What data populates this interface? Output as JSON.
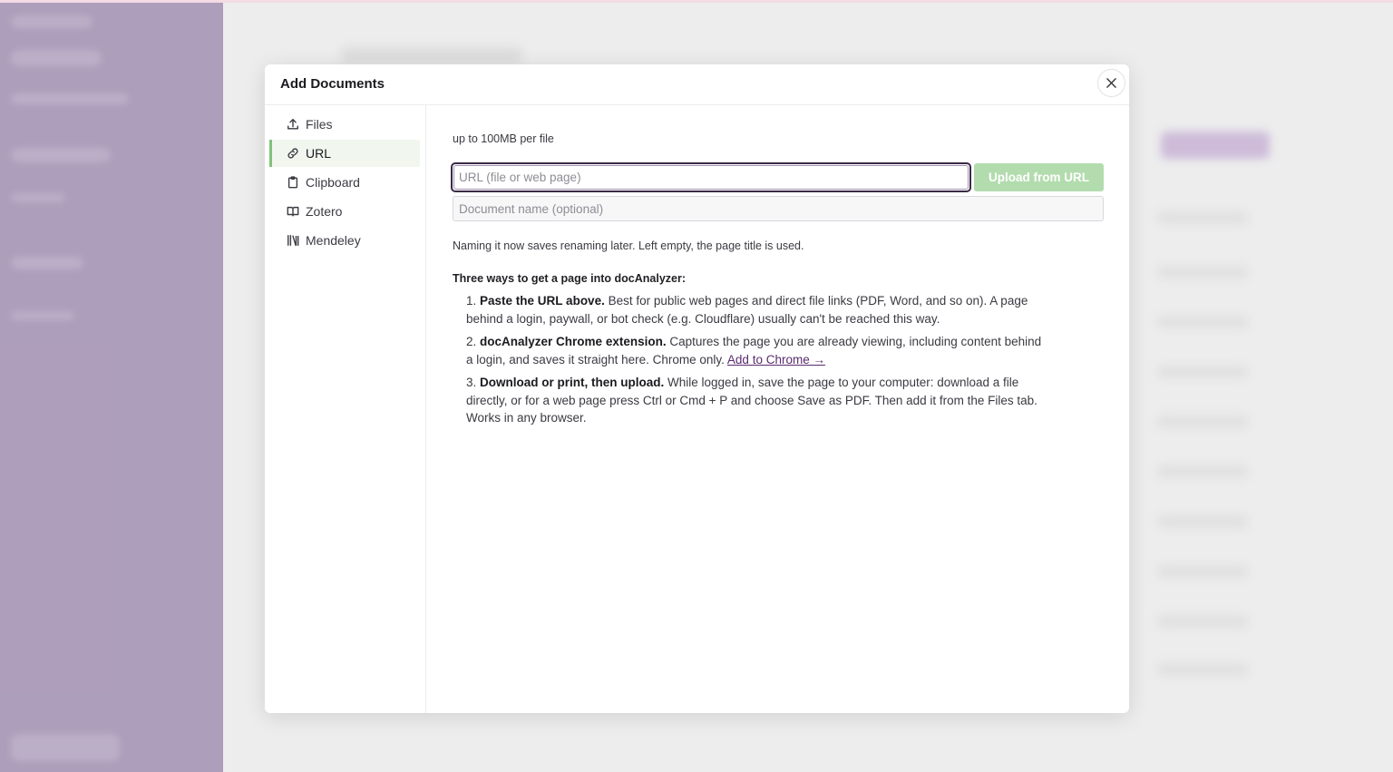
{
  "modal": {
    "title": "Add Documents"
  },
  "nav": {
    "items": [
      {
        "label": "Files",
        "icon": "upload-icon"
      },
      {
        "label": "URL",
        "icon": "link-icon"
      },
      {
        "label": "Clipboard",
        "icon": "clipboard-icon"
      },
      {
        "label": "Zotero",
        "icon": "book-open-icon"
      },
      {
        "label": "Mendeley",
        "icon": "library-icon"
      }
    ],
    "active": "URL"
  },
  "url_panel": {
    "limit_text": "up to 100MB per file",
    "url_placeholder": "URL (file or web page)",
    "url_value": "",
    "upload_label": "Upload from URL",
    "name_placeholder": "Document name (optional)",
    "name_value": "",
    "hint": "Naming it now saves renaming later. Left empty, the page title is used.",
    "ways_heading": "Three ways to get a page into docAnalyzer:",
    "ways": [
      {
        "num": "1.",
        "title": "Paste the URL above.",
        "text": "Best for public web pages and direct file links (PDF, Word, and so on). A page behind a login, paywall, or bot check (e.g. Cloudflare) usually can't be reached this way."
      },
      {
        "num": "2.",
        "title": "docAnalyzer Chrome extension.",
        "text": "Captures the page you are already viewing, including content behind a login, and saves it straight here. Chrome only.",
        "link": "Add to Chrome →"
      },
      {
        "num": "3.",
        "title": "Download or print, then upload.",
        "text": "While logged in, save the page to your computer: download a file directly, or for a web page press Ctrl or Cmd + P and choose Save as PDF. Then add it from the Files tab. Works in any browser."
      }
    ]
  },
  "colors": {
    "accent_green": "#7fc27a",
    "upload_button_bg": "#b3dcae",
    "focus_ring": "#3b2a45",
    "link": "#5a2a6e",
    "sidebar_bg": "#a796b6"
  }
}
